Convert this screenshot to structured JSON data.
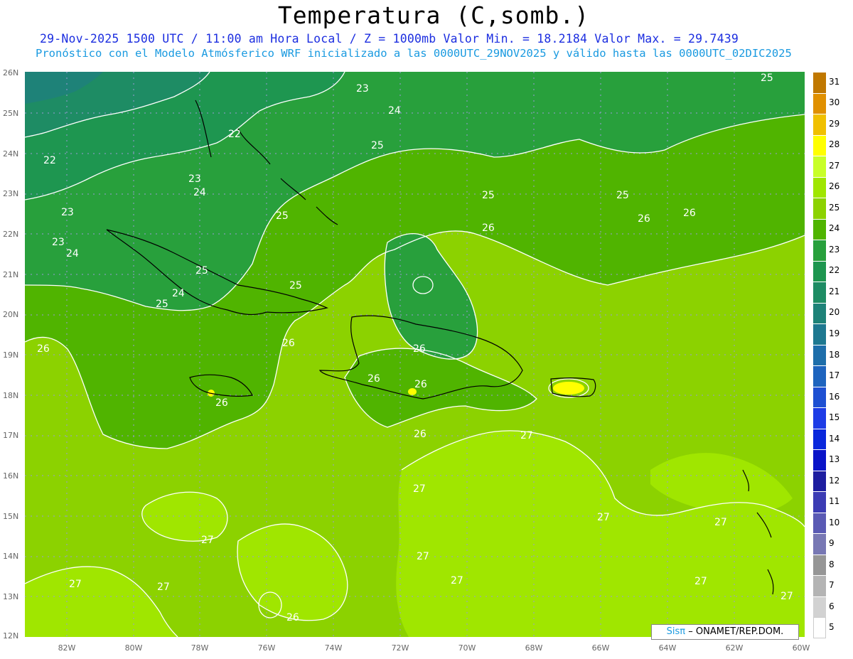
{
  "title": "Temperatura (C,somb.)",
  "subtitle1": "29-Nov-2025 1500 UTC / 11:00 am Hora Local / Z = 1000mb  Valor Min. = 18.2184  Valor Max. = 29.7439",
  "subtitle2": "Pronóstico con el Modelo Atmósferico WRF inicializado a las 0000UTC_29NOV2025 y válido hasta las  0000UTC_02DIC2025",
  "lat_ticks": [
    "26N",
    "25N",
    "24N",
    "23N",
    "22N",
    "21N",
    "20N",
    "19N",
    "18N",
    "17N",
    "16N",
    "15N",
    "14N",
    "13N",
    "12N"
  ],
  "lon_ticks": [
    "82W",
    "80W",
    "78W",
    "76W",
    "74W",
    "72W",
    "70W",
    "68W",
    "66W",
    "64W",
    "62W",
    "60W"
  ],
  "colorbar": {
    "levels": [
      "31",
      "30",
      "29",
      "28",
      "27",
      "26",
      "25",
      "24",
      "23",
      "22",
      "21",
      "20",
      "19",
      "18",
      "17",
      "16",
      "15",
      "14",
      "13",
      "12",
      "11",
      "10",
      "9",
      "8",
      "7",
      "6",
      "5"
    ],
    "colors": [
      "#c07800",
      "#e09000",
      "#f0c000",
      "#ffff00",
      "#c8ff28",
      "#a0e600",
      "#8cd200",
      "#50b400",
      "#28a03c",
      "#1e9650",
      "#1e8c64",
      "#1e8278",
      "#1e7890",
      "#1e6eaa",
      "#1e64be",
      "#1e50d2",
      "#1e3ce6",
      "#0a28dc",
      "#0a14c8",
      "#1e1ea0",
      "#3c3cb4",
      "#5a5ab4",
      "#7878b4",
      "#969696",
      "#b4b4b4",
      "#d2d2d2",
      "#ffffff"
    ]
  },
  "contour_labels": [
    {
      "text": "23"
    },
    {
      "text": "24"
    },
    {
      "text": "22"
    },
    {
      "text": "22"
    },
    {
      "text": "25"
    },
    {
      "text": "23"
    },
    {
      "text": "24"
    },
    {
      "text": "23"
    },
    {
      "text": "23"
    },
    {
      "text": "24"
    },
    {
      "text": "25"
    },
    {
      "text": "25"
    },
    {
      "text": "24"
    },
    {
      "text": "25"
    },
    {
      "text": "25"
    },
    {
      "text": "25"
    },
    {
      "text": "25"
    },
    {
      "text": "26"
    },
    {
      "text": "26"
    },
    {
      "text": "26"
    },
    {
      "text": "26"
    },
    {
      "text": "26"
    },
    {
      "text": "26"
    },
    {
      "text": "26"
    },
    {
      "text": "26"
    },
    {
      "text": "26"
    },
    {
      "text": "26"
    },
    {
      "text": "27"
    },
    {
      "text": "27"
    },
    {
      "text": "27"
    },
    {
      "text": "27"
    },
    {
      "text": "27"
    },
    {
      "text": "27"
    },
    {
      "text": "27"
    },
    {
      "text": "27"
    },
    {
      "text": "27"
    },
    {
      "text": "27"
    },
    {
      "text": "27"
    },
    {
      "text": "25"
    },
    {
      "text": "26"
    }
  ],
  "credit": {
    "logo": "Sisπ",
    "text": "– ONAMET/REP.DOM."
  }
}
